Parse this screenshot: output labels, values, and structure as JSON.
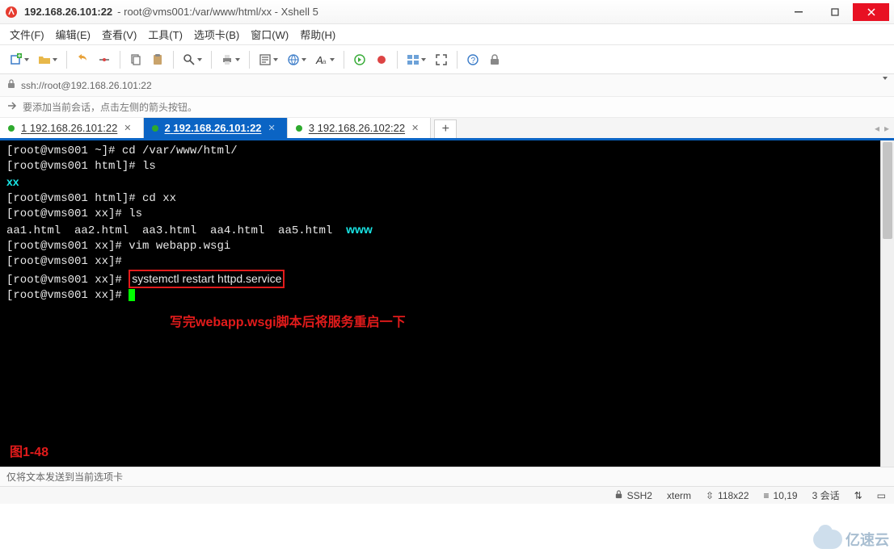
{
  "window": {
    "title_main": "192.168.26.101:22",
    "title_sub": "root@vms001:/var/www/html/xx - Xshell 5"
  },
  "menu": {
    "file": "文件(F)",
    "edit": "编辑(E)",
    "view": "查看(V)",
    "tools": "工具(T)",
    "tabs": "选项卡(B)",
    "window": "窗口(W)",
    "help": "帮助(H)"
  },
  "address": {
    "url": "ssh://root@192.168.26.101:22"
  },
  "hint": {
    "text": "要添加当前会话，点击左侧的箭头按钮。"
  },
  "tabs": [
    {
      "index": "1",
      "label": "192.168.26.101:22",
      "active": false
    },
    {
      "index": "2",
      "label": "192.168.26.101:22",
      "active": true
    },
    {
      "index": "3",
      "label": "192.168.26.102:22",
      "active": false
    }
  ],
  "terminal": {
    "lines": [
      {
        "prompt": "[root@vms001 ~]# ",
        "cmd": "cd /var/www/html/"
      },
      {
        "prompt": "[root@vms001 html]# ",
        "cmd": "ls"
      },
      {
        "out_cyan": "xx"
      },
      {
        "prompt": "[root@vms001 html]# ",
        "cmd": "cd xx"
      },
      {
        "prompt": "[root@vms001 xx]# ",
        "cmd": "ls"
      },
      {
        "out_files": "aa1.html  aa2.html  aa3.html  aa4.html  aa5.html  ",
        "out_cyan": "www"
      },
      {
        "prompt": "[root@vms001 xx]# ",
        "cmd": "vim webapp.wsgi"
      },
      {
        "prompt": "[root@vms001 xx]# ",
        "cmd": ""
      },
      {
        "prompt": "[root@vms001 xx]# ",
        "cmd_boxed": "systemctl restart httpd.service"
      },
      {
        "prompt": "[root@vms001 xx]# ",
        "cursor": true
      }
    ],
    "note": "写完webapp.wsgi脚本后将服务重启一下",
    "figure_label": "图1-48"
  },
  "sendbar": {
    "text": "仅将文本发送到当前选项卡"
  },
  "status": {
    "protocol": "SSH2",
    "term": "xterm",
    "size": "118x22",
    "cursor": "10,19",
    "sessions": "3 会话"
  },
  "watermark": {
    "text": "亿速云"
  }
}
